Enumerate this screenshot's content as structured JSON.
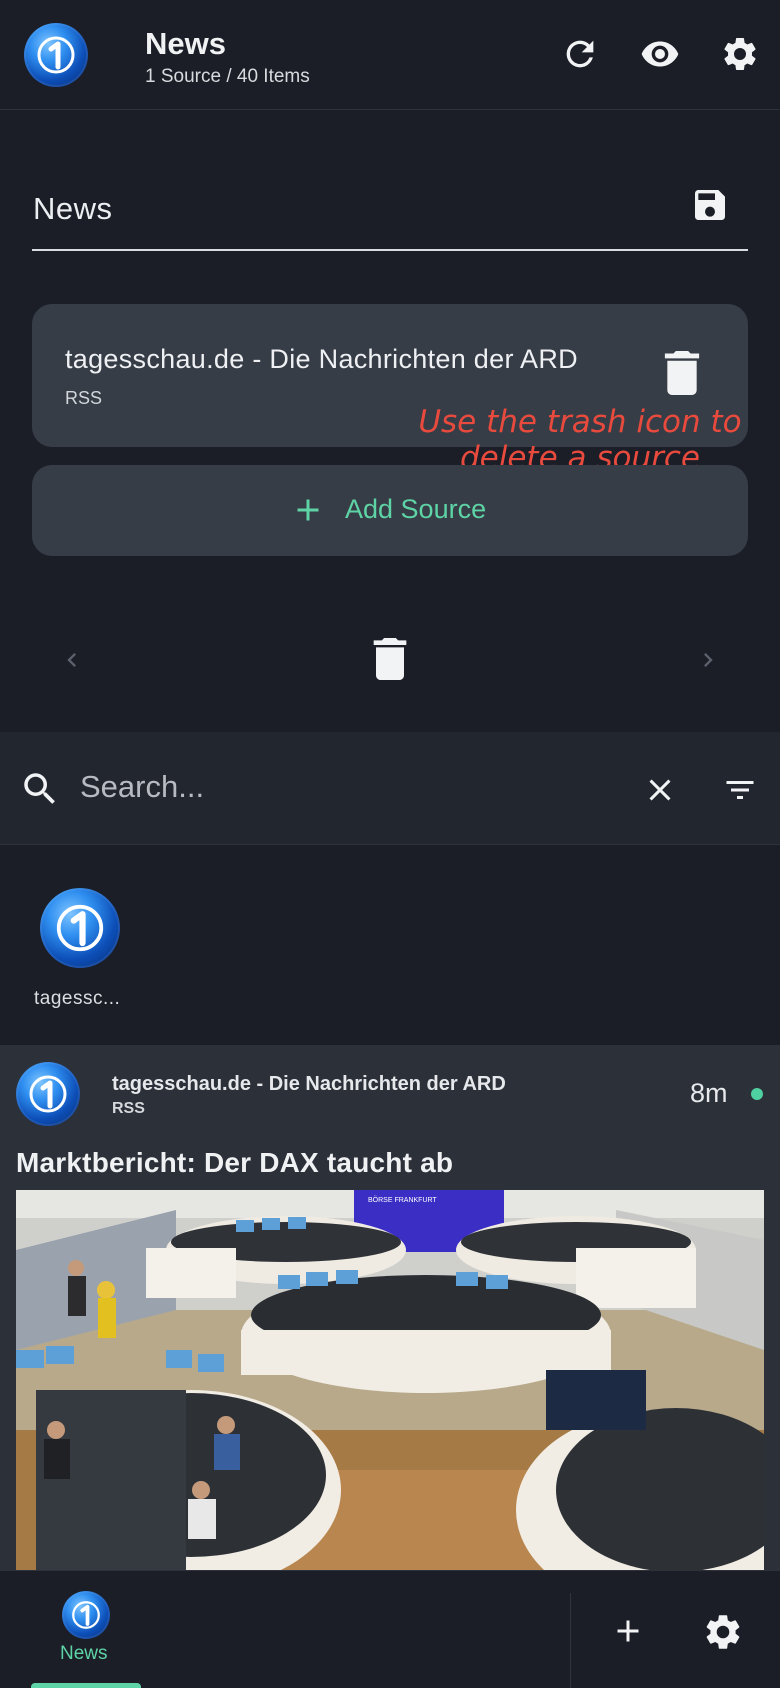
{
  "header": {
    "title": "News",
    "subtitle": "1 Source / 40 Items",
    "icons": [
      "app-logo",
      "refresh-icon",
      "eye-icon",
      "gear-icon"
    ]
  },
  "editor": {
    "name_value": "News",
    "save_icon": "save-icon",
    "source": {
      "name": "tagesschau.de - Die Nachrichten der ARD",
      "type": "RSS",
      "delete_icon": "trash-icon"
    },
    "annotation": "Use the trash icon to delete a source",
    "add_source_label": "Add Source",
    "pager_icons": [
      "chevron-left-icon",
      "trash-icon",
      "chevron-right-icon"
    ]
  },
  "search": {
    "placeholder": "Search...",
    "value": ""
  },
  "source_avatars": [
    {
      "label": "tagessc..."
    }
  ],
  "article": {
    "source": "tagesschau.de - Die Nachrichten der ARD",
    "type": "RSS",
    "time": "8m",
    "title": "Marktbericht: Der DAX taucht ab",
    "image_sign": "BÖRSE FRANKFURT"
  },
  "bottom_nav": {
    "active_label": "News",
    "icons": [
      "plus-icon",
      "gear-icon"
    ]
  },
  "colors": {
    "background": "#1b1e27",
    "card": "#363d46",
    "accent": "#5ed3a6",
    "annotation": "#e84a3d"
  }
}
